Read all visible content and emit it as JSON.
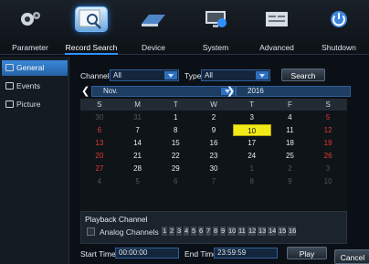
{
  "nav": {
    "items": [
      {
        "label": "Parameter",
        "icon": "gear-icon"
      },
      {
        "label": "Record Search",
        "icon": "search-icon",
        "active": true
      },
      {
        "label": "Device",
        "icon": "hdd-icon"
      },
      {
        "label": "System",
        "icon": "monitor-info-icon"
      },
      {
        "label": "Advanced",
        "icon": "advanced-icon"
      },
      {
        "label": "Shutdown",
        "icon": "power-icon"
      }
    ]
  },
  "sidebar": {
    "items": [
      {
        "label": "General",
        "active": true,
        "icon": "general-icon"
      },
      {
        "label": "Events",
        "icon": "events-icon"
      },
      {
        "label": "Picture",
        "icon": "picture-icon"
      }
    ]
  },
  "search": {
    "channel_label": "Channel",
    "channel_value": "All",
    "type_label": "Type",
    "type_value": "All",
    "search_button": "Search"
  },
  "calendar": {
    "month": "Nov.",
    "year": "2016",
    "weekdays": [
      "S",
      "M",
      "T",
      "W",
      "T",
      "F",
      "S"
    ],
    "weeks": [
      [
        {
          "d": "30",
          "c": "muted"
        },
        {
          "d": "31",
          "c": "muted"
        },
        {
          "d": "1"
        },
        {
          "d": "2"
        },
        {
          "d": "3"
        },
        {
          "d": "4"
        },
        {
          "d": "5",
          "c": "red"
        }
      ],
      [
        {
          "d": "6",
          "c": "red"
        },
        {
          "d": "7"
        },
        {
          "d": "8"
        },
        {
          "d": "9"
        },
        {
          "d": "10",
          "c": "sel"
        },
        {
          "d": "11"
        },
        {
          "d": "12",
          "c": "red"
        }
      ],
      [
        {
          "d": "13",
          "c": "red"
        },
        {
          "d": "14"
        },
        {
          "d": "15"
        },
        {
          "d": "16"
        },
        {
          "d": "17"
        },
        {
          "d": "18"
        },
        {
          "d": "19",
          "c": "red"
        }
      ],
      [
        {
          "d": "20",
          "c": "red"
        },
        {
          "d": "21"
        },
        {
          "d": "22"
        },
        {
          "d": "23"
        },
        {
          "d": "24"
        },
        {
          "d": "25"
        },
        {
          "d": "26",
          "c": "red"
        }
      ],
      [
        {
          "d": "27",
          "c": "red"
        },
        {
          "d": "28"
        },
        {
          "d": "29"
        },
        {
          "d": "30"
        },
        {
          "d": "1",
          "c": "muted"
        },
        {
          "d": "2",
          "c": "muted"
        },
        {
          "d": "3",
          "c": "muted"
        }
      ],
      [
        {
          "d": "4",
          "c": "muted"
        },
        {
          "d": "5",
          "c": "muted"
        },
        {
          "d": "6",
          "c": "muted"
        },
        {
          "d": "7",
          "c": "muted"
        },
        {
          "d": "8",
          "c": "muted"
        },
        {
          "d": "9",
          "c": "muted"
        },
        {
          "d": "10",
          "c": "muted"
        }
      ]
    ]
  },
  "playback": {
    "title": "Playback Channel",
    "analog_label": "Analog Channels",
    "channels": [
      "1",
      "2",
      "3",
      "4",
      "5",
      "6",
      "7",
      "8",
      "9",
      "10",
      "11",
      "12",
      "13",
      "14",
      "15",
      "16"
    ]
  },
  "time": {
    "start_label": "Start Time",
    "start_value": "00:00:00",
    "end_label": "End Time",
    "end_value": "23:59:59",
    "play_button": "Play"
  },
  "cancel_button": "Cancel",
  "colors": {
    "accent": "#2f8fff",
    "selected_day": "#f2ea18",
    "weekend": "#e23b32"
  }
}
